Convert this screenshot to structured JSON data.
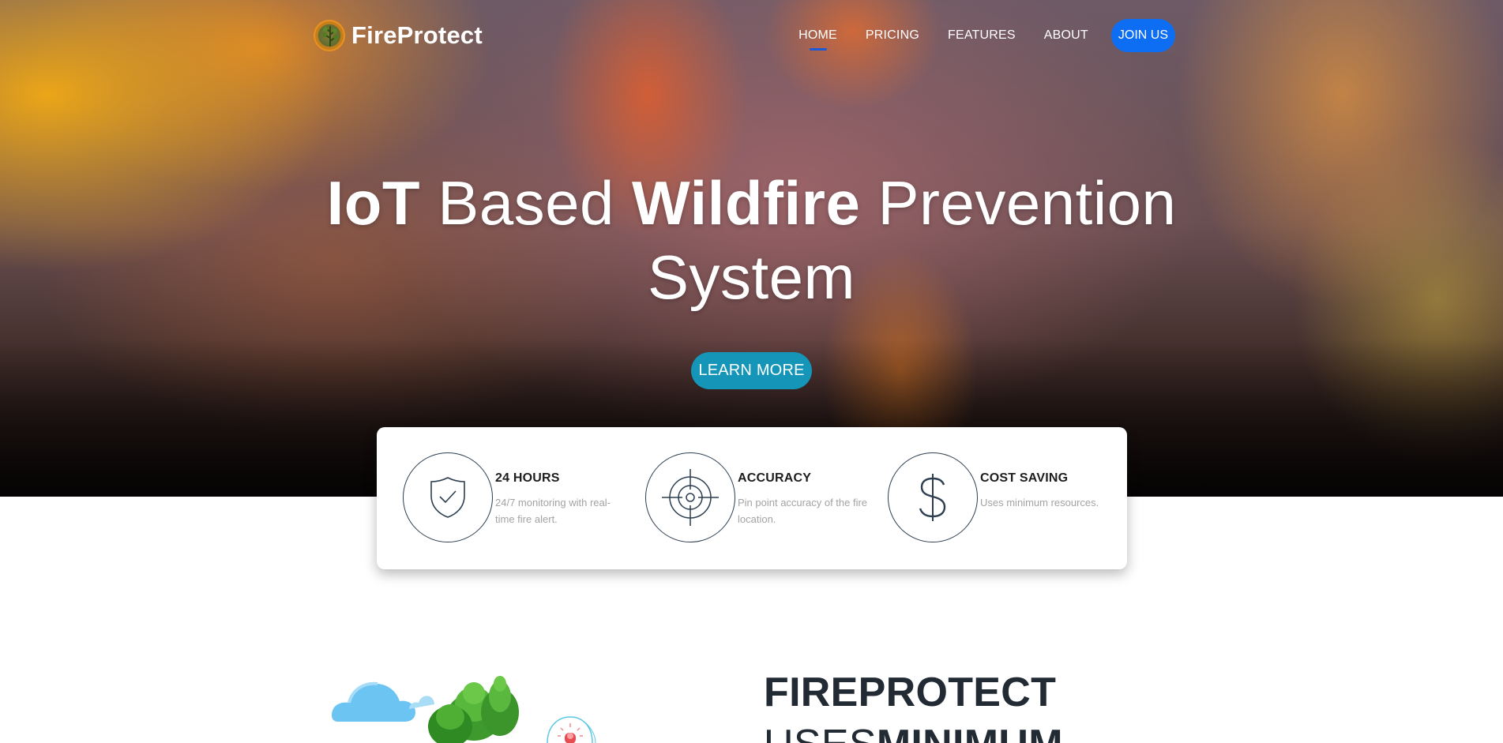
{
  "brand": {
    "name": "FireProtect",
    "logo_icon": "tree-icon"
  },
  "nav": {
    "items": [
      {
        "label": "HOME",
        "active": true
      },
      {
        "label": "PRICING"
      },
      {
        "label": "FEATURES"
      },
      {
        "label": "ABOUT"
      }
    ],
    "join_label": "JOIN US",
    "accent_color": "#0d6ef4"
  },
  "hero": {
    "title_parts": [
      "IoT",
      "Based",
      "Wildfire",
      "Prevention"
    ],
    "title_line2": "System",
    "cta_label": "LEARN MORE",
    "cta_color": "#1596b8"
  },
  "features": [
    {
      "icon": "shield-check-icon",
      "title": "24 HOURS",
      "desc": "24/7 monitoring with real-time fire alert."
    },
    {
      "icon": "crosshair-icon",
      "title": "ACCURACY",
      "desc": "Pin point accuracy of the fire location."
    },
    {
      "icon": "dollar-icon",
      "title": "COST SAVING",
      "desc": "Uses minimum resources."
    }
  ],
  "section": {
    "title_line1": "FIREPROTECT",
    "title_line2_light": "USES",
    "title_line2_bold": "MINIMUM"
  }
}
